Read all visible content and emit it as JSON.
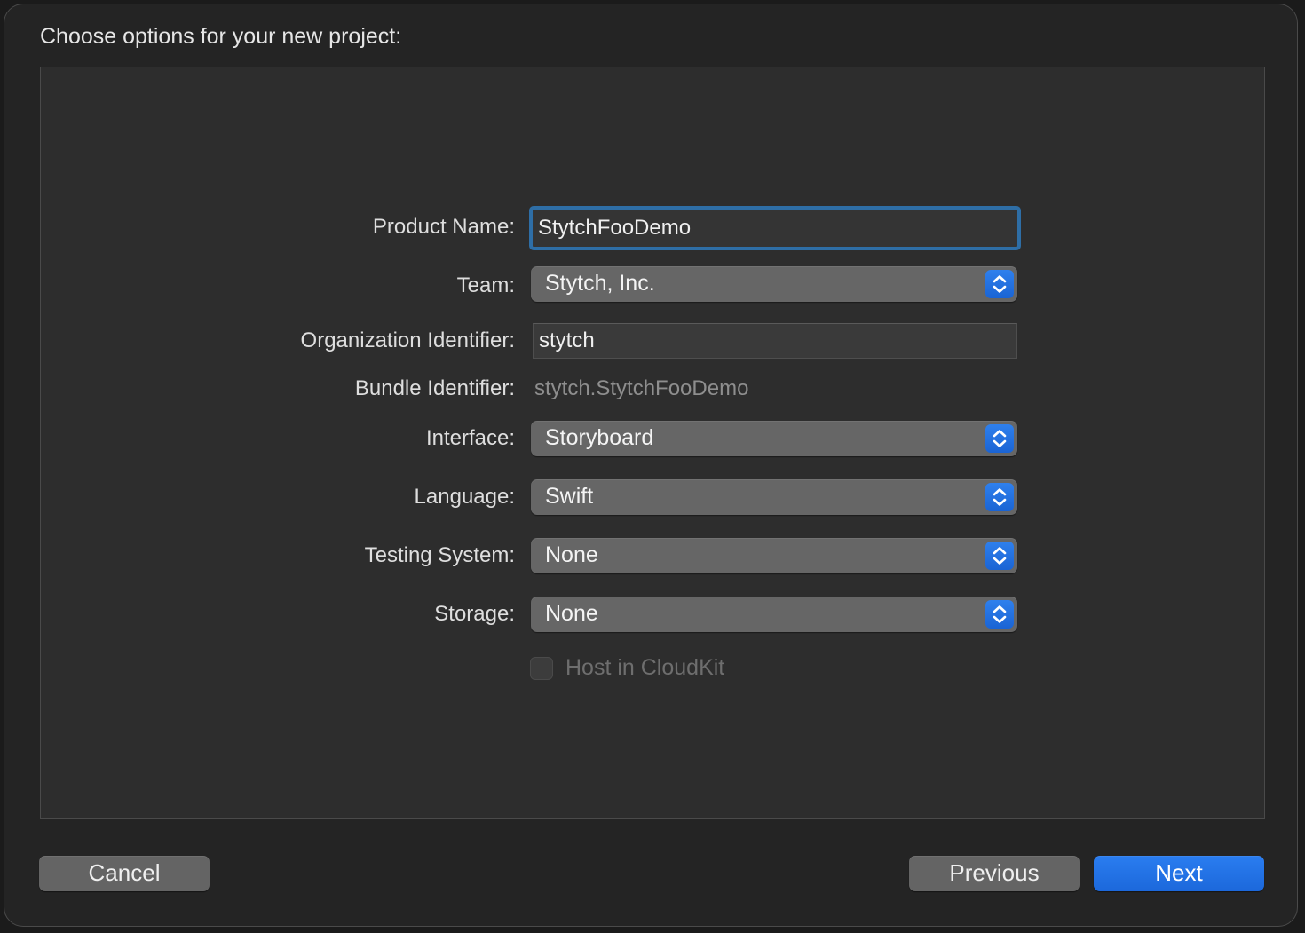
{
  "dialog": {
    "title": "Choose options for your new project:"
  },
  "form": {
    "product_name": {
      "label": "Product Name:",
      "value": "StytchFooDemo"
    },
    "team": {
      "label": "Team:",
      "value": "Stytch, Inc."
    },
    "organization_identifier": {
      "label": "Organization Identifier:",
      "value": "stytch"
    },
    "bundle_identifier": {
      "label": "Bundle Identifier:",
      "value": "stytch.StytchFooDemo"
    },
    "interface": {
      "label": "Interface:",
      "value": "Storyboard"
    },
    "language": {
      "label": "Language:",
      "value": "Swift"
    },
    "testing_system": {
      "label": "Testing System:",
      "value": "None"
    },
    "storage": {
      "label": "Storage:",
      "value": "None"
    },
    "host_in_cloudkit": {
      "label": "Host in CloudKit",
      "checked": false,
      "enabled": false
    }
  },
  "buttons": {
    "cancel": "Cancel",
    "previous": "Previous",
    "next": "Next"
  },
  "icons": {
    "popup_stepper": "chevron-up-down-icon"
  },
  "colors": {
    "accent": "#1c68db",
    "focus_ring": "#2e6ea6",
    "dialog_bg": "#242424",
    "panel_bg": "#2d2d2d"
  }
}
